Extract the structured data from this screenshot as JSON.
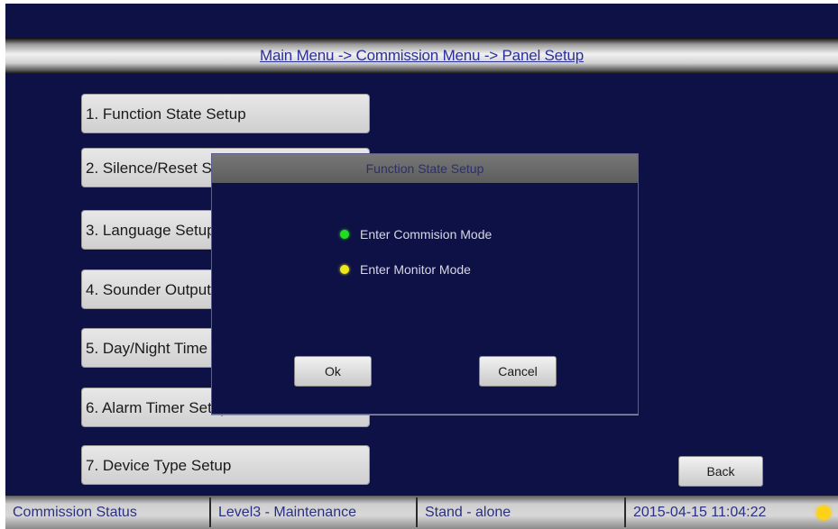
{
  "breadcrumb": "Main Menu -> Commission Menu -> Panel Setup",
  "menu_items": [
    "1. Function State Setup",
    "2. Silence/Reset Setup",
    "3. Language Setup",
    "4. Sounder Output Setup",
    "5. Day/Night Time Setup",
    "6. Alarm Timer Setup",
    "7. Device Type Setup"
  ],
  "dialog": {
    "title": "Function State Setup",
    "options": [
      {
        "label": "Enter Commision Mode",
        "color": "#22dd22"
      },
      {
        "label": "Enter Monitor Mode",
        "color": "#f0e81a"
      }
    ],
    "ok_label": "Ok",
    "cancel_label": "Cancel"
  },
  "back_label": "Back",
  "status_bar": {
    "mode": "Commission Status",
    "level": "Level3 - Maintenance",
    "network": "Stand - alone",
    "datetime": "2015-04-15 11:04:22",
    "lamp_color": "#ffd21a",
    "lamp_icon": "status-lamp-icon"
  }
}
